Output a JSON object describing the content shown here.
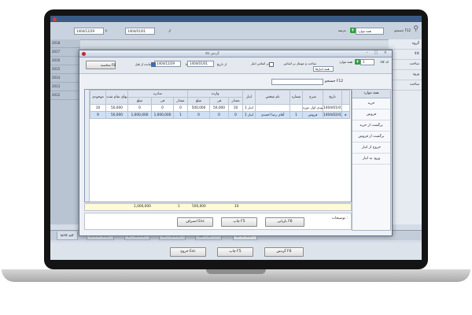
{
  "background": {
    "toolbar": {
      "search_label": "جستجو F12",
      "field_label": "عرضه",
      "from_date": "1404/01/01",
      "to_date": "1404/12/29",
      "from_label": "از",
      "to_label": "تا",
      "find_label": "یافتن"
    },
    "left_column": [
      "2018",
      "2017",
      "2016",
      "2015",
      "2014",
      "2013",
      "2012"
    ],
    "right_list": [
      "گروه",
      "کالا",
      "ساخت",
      "ورود",
      "ساخت"
    ],
    "tabs": [
      "کلیه کالاها",
      "دارایی موجودی",
      "موجودی صفر",
      "موجودی منفی",
      "کالاهای کسری",
      "دارای گردش"
    ],
    "buttons": {
      "exit": "خروج Esc",
      "print": "چاپ F5",
      "report": "گردش F6"
    }
  },
  "dialog": {
    "title": "گردش کالا",
    "window_controls": "– □ ×",
    "toolbar": {
      "goods_code_label": "کد کالا",
      "goods_code_value": "1",
      "all_label": "همه موارد",
      "inventory_button": "محاسبه F8",
      "show_label": "ساخت و مونتاژ بر اساس",
      "all_warehouses": "همه انبارها",
      "from_date_label": "از تاریخ",
      "from_date": "1404/01/01",
      "to_date_label": "تا",
      "to_date": "1404/12/29",
      "before_label": "مانده از قبل",
      "based_on_label": "بر اساس انبار"
    },
    "search_label": "جستجو F12",
    "side_panel": {
      "header": "همه موارد",
      "items": [
        "خرید",
        "فروش",
        "برگشت از خرید",
        "برگشت از فروش",
        "خروج از انبار",
        "ورود به انبار"
      ]
    },
    "grid": {
      "group_headers": {
        "incoming": "وارده",
        "outgoing": "صادره"
      },
      "columns": [
        "موجودی",
        "بهای تمام شده",
        "مبلغ",
        "فی",
        "مقدار",
        "مبلغ",
        "فی",
        "مقدار",
        "انبار",
        "نام شخص",
        "شماره",
        "شرح",
        "تاریخ"
      ],
      "rows": [
        {
          "balance": "10",
          "cost": "50,000",
          "out_amount": "0",
          "out_price": "0",
          "out_qty": "0",
          "in_amount": "500,000",
          "in_price": "50,000",
          "in_qty": "10",
          "warehouse": "انبار 1",
          "person": "",
          "number": "",
          "desc": "موجودی اول دوره",
          "date": "1404/01/01"
        },
        {
          "balance": "9",
          "cost": "50,000",
          "out_amount": "1,000,000",
          "out_price": "1,000,000",
          "out_qty": "1",
          "in_amount": "0",
          "in_price": "0",
          "in_qty": "0",
          "warehouse": "انبار 1",
          "person": "آقای رضا احمدی",
          "number": "1",
          "desc": "فروش",
          "date": "1404/02/02"
        }
      ],
      "totals": {
        "out_amount": "1,000,000",
        "out_qty": "1",
        "in_amount": "500,000",
        "in_qty": "10"
      }
    },
    "notes_label": "توضیحات :",
    "buttons": {
      "exit": "انصراف Esc",
      "print": "چاپ F5",
      "refresh": "بازیابی F6"
    }
  }
}
